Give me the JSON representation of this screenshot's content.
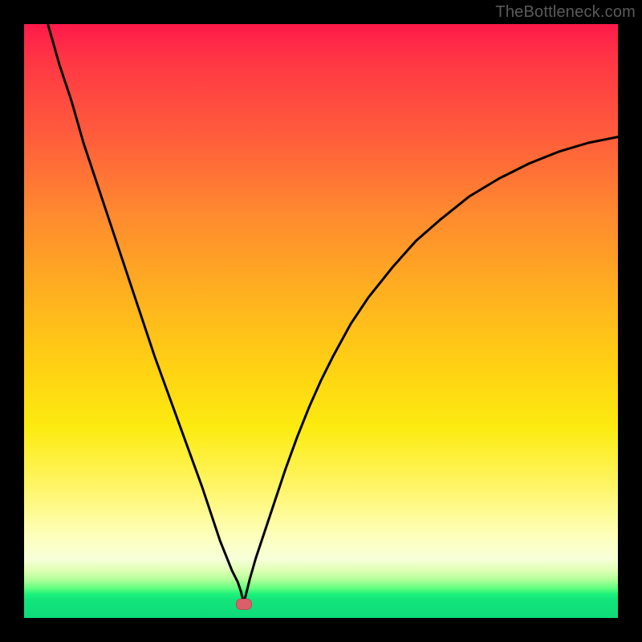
{
  "watermark": "TheBottleneck.com",
  "marker": {
    "x_pct": 37.0,
    "y_pct": 97.7
  },
  "chart_data": {
    "type": "line",
    "title": "",
    "xlabel": "",
    "ylabel": "",
    "xlim": [
      0,
      100
    ],
    "ylim": [
      0,
      100
    ],
    "series": [
      {
        "name": "bottleneck-curve",
        "x": [
          4,
          6,
          8,
          10,
          12,
          14,
          16,
          18,
          20,
          22,
          24,
          26,
          28,
          30,
          32,
          33,
          34,
          35,
          36,
          36.5,
          37,
          37.5,
          38,
          39,
          40,
          42,
          44,
          46,
          48,
          50,
          52,
          55,
          58,
          62,
          66,
          70,
          75,
          80,
          85,
          90,
          95,
          100
        ],
        "y": [
          100,
          93,
          87,
          80,
          74,
          68,
          62,
          56,
          50,
          44,
          38.5,
          33,
          27.5,
          22,
          16,
          13,
          10.5,
          8,
          6,
          4.5,
          2.5,
          4.5,
          6.5,
          10,
          13,
          19,
          25,
          30.5,
          35.5,
          40,
          44,
          49.5,
          54,
          59,
          63.5,
          67,
          71,
          74,
          76.5,
          78.5,
          80,
          81
        ]
      }
    ],
    "annotations": [
      {
        "text": "TheBottleneck.com",
        "position": "top-right"
      }
    ],
    "legend": false,
    "grid": false
  }
}
